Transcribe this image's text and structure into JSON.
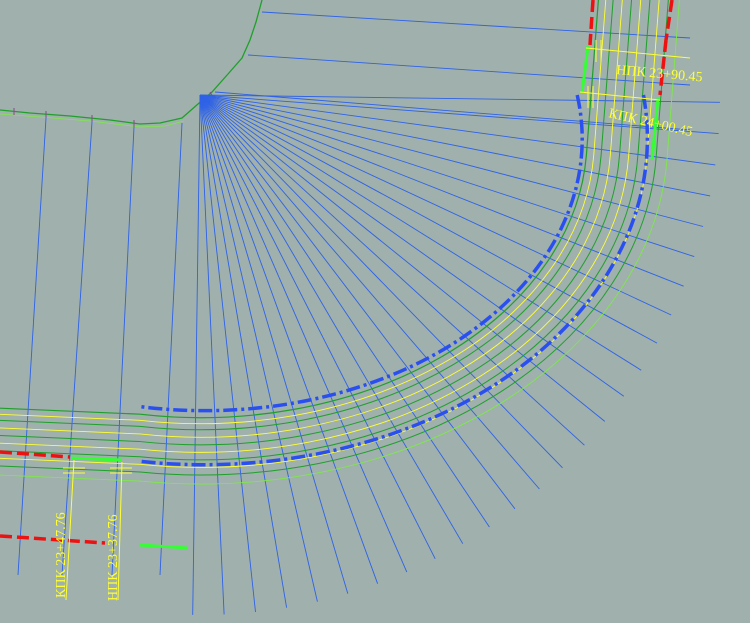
{
  "drawing": {
    "background": "#9fb0ad",
    "colors": {
      "section_line": "#2f62e6",
      "edge_line": "#1fa02a",
      "lane_line": "#ffff33",
      "outer_line": "#7fe84a",
      "dash_blue": "#2a4ff0",
      "dash_red": "#ee1111",
      "highlight_green": "#33ff33",
      "tick": "#8a4a8a"
    },
    "labels": [
      {
        "id": "nk-top",
        "text": "НПК 23+90.45"
      },
      {
        "id": "kk-top",
        "text": "КПК 24+00.45"
      },
      {
        "id": "kk-bottom",
        "text": "КПК 23+47.76"
      },
      {
        "id": "nk-bottom",
        "text": "НПК 23+37.76"
      }
    ]
  }
}
